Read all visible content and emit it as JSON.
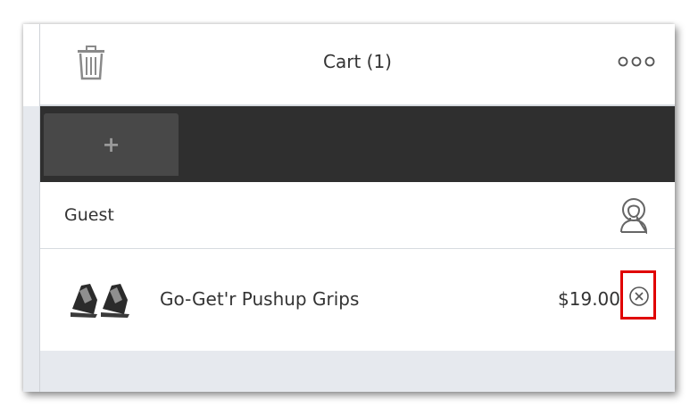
{
  "header": {
    "title": "Cart (1)",
    "trash_icon": "trash-icon",
    "more_icon": "more-options-icon"
  },
  "tabs": {
    "add_label": "+"
  },
  "customer": {
    "name": "Guest",
    "icon": "user-icon"
  },
  "cart": {
    "items": [
      {
        "name": "Go-Get'r Pushup Grips",
        "price": "$19.00",
        "image_icon": "pushup-grips-image",
        "remove_icon": "remove-circle-x-icon"
      }
    ]
  },
  "colors": {
    "tab_bar": "#2f2f2f",
    "add_tab": "#484848",
    "highlight": "#e00000",
    "footer": "#e6e9ee"
  }
}
